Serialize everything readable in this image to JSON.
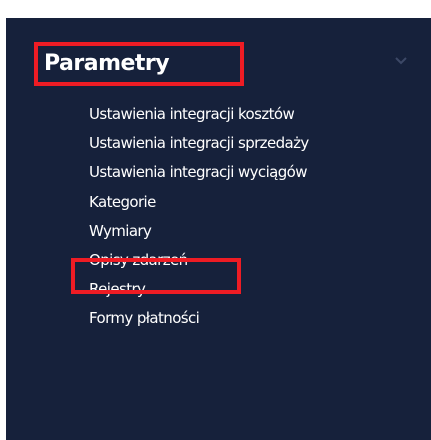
{
  "section": {
    "title": "Parametry",
    "chevron_icon": "chevron-down-icon",
    "highlight_color": "#ee1c24"
  },
  "menu": {
    "items": [
      {
        "label": "Ustawienia integracji kosztów"
      },
      {
        "label": "Ustawienia integracji sprzedaży"
      },
      {
        "label": "Ustawienia integracji wyciągów"
      },
      {
        "label": "Kategorie"
      },
      {
        "label": "Wymiary",
        "highlighted": true
      },
      {
        "label": "Opisy zdarzeń"
      },
      {
        "label": "Rejestry"
      },
      {
        "label": "Formy płatności"
      }
    ]
  },
  "colors": {
    "panel_background": "#16213b",
    "text": "#ffffff",
    "annotation_box": "#ee1c24"
  }
}
